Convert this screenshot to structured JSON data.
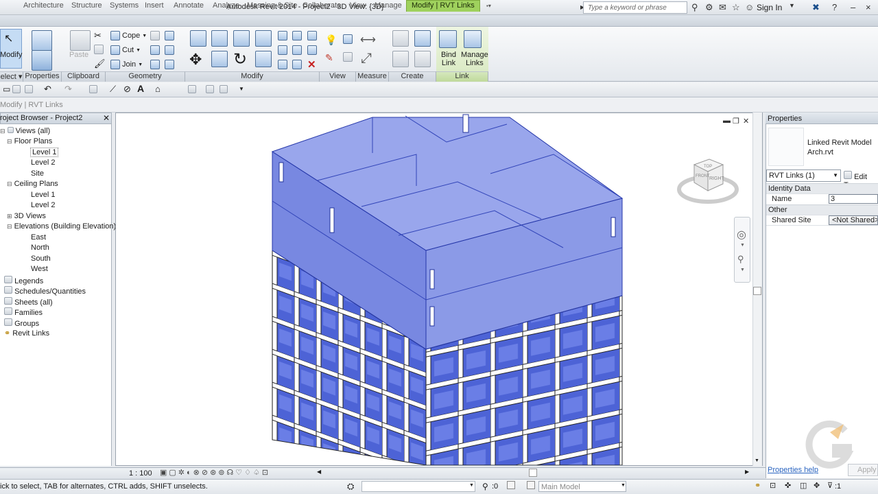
{
  "title": "Autodesk Revit 2014 -   Project2 - 3D View: {3D}",
  "search_placeholder": "Type a keyword or phrase",
  "sign_in": "Sign In",
  "tabs": [
    "Architecture",
    "Structure",
    "Systems",
    "Insert",
    "Annotate",
    "Analyze",
    "Massing & Site",
    "Collaborate",
    "View",
    "Manage",
    "Modify | RVT Links"
  ],
  "ribbon": {
    "modify": "Modify",
    "select": "elect",
    "properties": "Properties",
    "paste": "Paste",
    "clipboard": "Clipboard",
    "cope": "Cope",
    "cut": "Cut",
    "join": "Join",
    "geometry": "Geometry",
    "modify_panel": "Modify",
    "view": "View",
    "measure": "Measure",
    "create": "Create",
    "bind_link": "Bind Link",
    "bind_link_1": "Bind",
    "bind_link_2": "Link",
    "manage_links_1": "Manage",
    "manage_links_2": "Links",
    "link": "Link"
  },
  "context_label": "Modify | RVT Links",
  "project_browser": {
    "title": "roject Browser - Project2",
    "items": [
      "Views (all)",
      "Floor Plans",
      "Level 1",
      "Level 2",
      "Site",
      "Ceiling Plans",
      "Level 1",
      "Level 2",
      "3D Views",
      "Elevations (Building Elevation)",
      "East",
      "North",
      "South",
      "West",
      "Legends",
      "Schedules/Quantities",
      "Sheets (all)",
      "Families",
      "Groups",
      "Revit Links"
    ]
  },
  "properties": {
    "title": "Properties",
    "type_name_1": "Linked Revit Model",
    "type_name_2": "Arch.rvt",
    "selector": "RVT Links (1)",
    "edit_type": "Edit Typ",
    "identity_data": "Identity Data",
    "name_label": "Name",
    "name_value": "3",
    "other": "Other",
    "shared_site_label": "Shared Site",
    "shared_site_value": "<Not Shared>",
    "help": "Properties help",
    "apply": "Apply"
  },
  "viewcube": {
    "top": "TOP",
    "left": "FRONT",
    "right": "RIGHT"
  },
  "scale": "1 : 100",
  "status_text": "ick to select, TAB for alternates, CTRL adds, SHIFT unselects.",
  "selection_count": ":0",
  "workset": "Main Model",
  "filter_count": ":1",
  "colors": {
    "accent_tab": "#9fd15d",
    "building_glass": "#4d63d6",
    "building_frame": "#ffffff"
  }
}
